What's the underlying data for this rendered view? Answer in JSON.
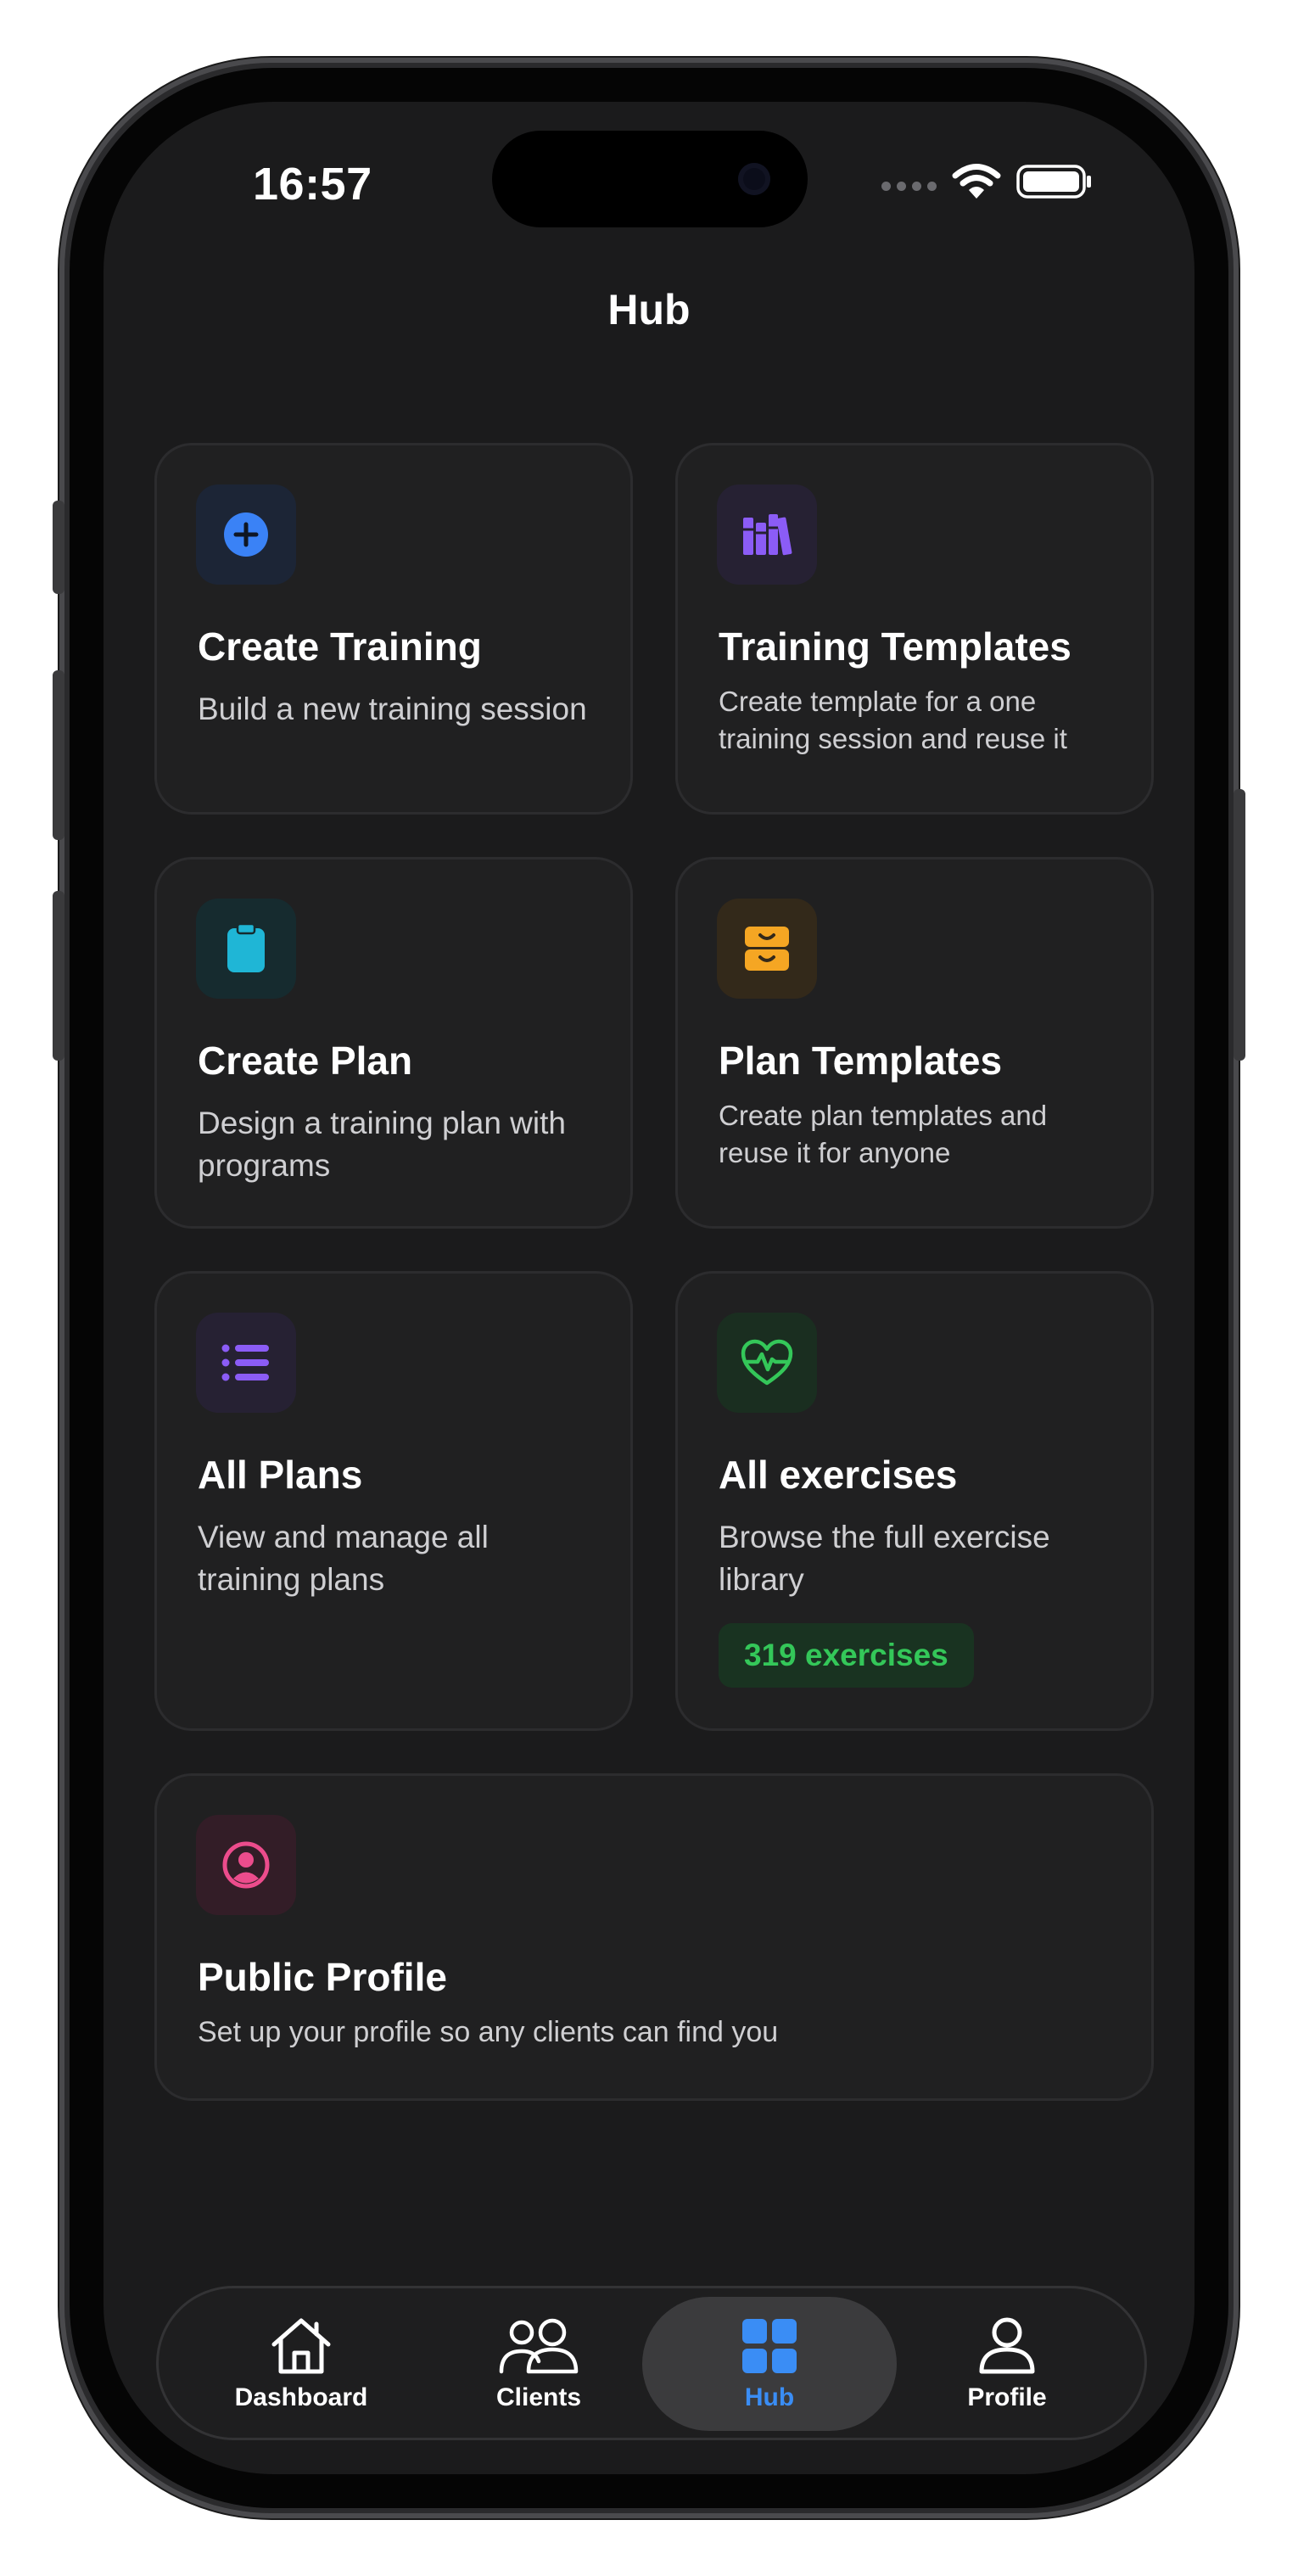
{
  "status_bar": {
    "time": "16:57"
  },
  "page": {
    "title": "Hub"
  },
  "cards": [
    {
      "id": "create-training",
      "title": "Create Training",
      "description": "Build a new training session",
      "icon": "plus-circle-icon",
      "accent": "#3a82f6",
      "tile": "#1c2536"
    },
    {
      "id": "training-templates",
      "title": "Training Templates",
      "description": "Create template for a one training session and reuse it",
      "icon": "books-icon",
      "accent": "#8b5cf6",
      "tile": "#262133"
    },
    {
      "id": "create-plan",
      "title": "Create Plan",
      "description": "Design a training plan with programs",
      "icon": "clipboard-icon",
      "accent": "#1fb6d6",
      "tile": "#162b2f"
    },
    {
      "id": "plan-templates",
      "title": "Plan Templates",
      "description": "Create plan templates and reuse it for anyone",
      "icon": "inbox-tray-icon",
      "accent": "#f5a623",
      "tile": "#33291a"
    },
    {
      "id": "all-plans",
      "title": "All Plans",
      "description": "View and manage all training plans",
      "icon": "list-icon",
      "accent": "#8b5cf6",
      "tile": "#262133"
    },
    {
      "id": "all-exercises",
      "title": "All exercises",
      "description": "Browse the full exercise library",
      "icon": "heart-pulse-icon",
      "accent": "#34c759",
      "tile": "#1a2e20",
      "badge": "319 exercises"
    },
    {
      "id": "public-profile",
      "title": "Public Profile",
      "description": "Set up your profile so any clients can find you",
      "icon": "user-circle-icon",
      "accent": "#ec4c8c",
      "tile": "#331d27"
    }
  ],
  "tabbar": {
    "tabs": [
      {
        "label": "Dashboard",
        "icon": "home-icon"
      },
      {
        "label": "Clients",
        "icon": "users-icon"
      },
      {
        "label": "Hub",
        "icon": "grid-icon",
        "active": true,
        "color": "#3a8df5"
      },
      {
        "label": "Profile",
        "icon": "user-icon"
      }
    ]
  }
}
